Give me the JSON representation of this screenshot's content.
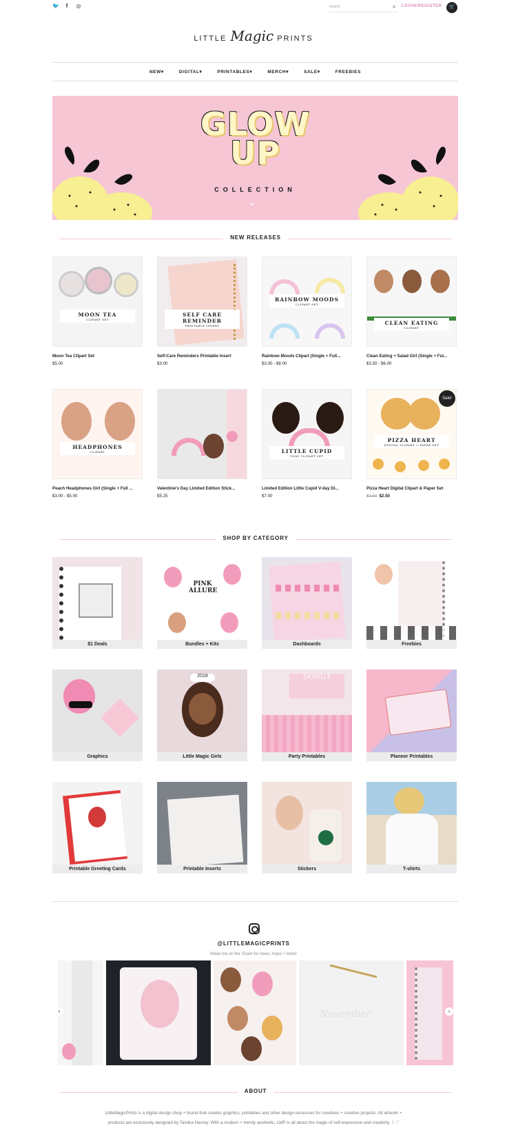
{
  "topbar": {
    "social_icons": [
      "twitter-icon",
      "facebook-icon",
      "instagram-icon"
    ],
    "search_placeholder": "Search",
    "login_label": "LOGIN/REGISTER"
  },
  "logo": {
    "left": "LITTLE",
    "middle": "Magic",
    "right": "PRINTS"
  },
  "nav": [
    "NEW",
    "DIGITAL",
    "PRINTABLES",
    "MERCH",
    "SALE",
    "FREEBIES"
  ],
  "hero": {
    "title_line1": "GLOW",
    "title_line2": "UP",
    "subtitle": "COLLECTION"
  },
  "new_releases": {
    "title": "NEW RELEASES",
    "products": [
      {
        "name": "Moon Tea Clipart Set",
        "price": "$5.00",
        "label": "MOON TEA",
        "sub": "CLIPART SET"
      },
      {
        "name": "Self-Care Reminders Printable Insert",
        "price": "$3.00",
        "label": "SELF CARE REMINDER",
        "sub": "PRINTABLE INSERT"
      },
      {
        "name": "Rainbow Moods Clipart (Single + Full...",
        "price": "$3.00 - $8.00",
        "label": "RAINBOW MOODS",
        "sub": "CLIPART SET"
      },
      {
        "name": "Clean Eating + Salad Girl (Single + Ful...",
        "price": "$3.50 - $6.00",
        "label": "CLEAN EATING",
        "sub": "CLIPART"
      },
      {
        "name": "Peach Headphones Girl (Single + Full ...",
        "price": "$3.00 - $5.00",
        "label": "HEADPHONES",
        "sub": "CLIPART"
      },
      {
        "name": "Valentine's Day Limited Edition Stick...",
        "price": "$5.25",
        "label": "",
        "sub": ""
      },
      {
        "name": "Limited Edition Little Cupid V-day Di...",
        "price": "$7.00",
        "label": "LITTLE CUPID",
        "sub": "VDAY CLIPART SET"
      },
      {
        "name": "Pizza Heart Digital Clipart & Paper Set",
        "old_price": "$3.50",
        "price": "$2.50",
        "label": "PIZZA HEART",
        "sub": "DIGITAL CLIPART + PAPER SET",
        "badge": "Sale!"
      }
    ]
  },
  "categories": {
    "title": "SHOP BY CATEGORY",
    "items": [
      "$1 Deals",
      "Bundles + Kits",
      "Dashboards",
      "Freebies",
      "Graphics",
      "Little Magic Girls",
      "Party Printables",
      "Planner Printables",
      "Printable Greeting Cards",
      "Printable Inserts",
      "Stickers",
      "T-shirts"
    ]
  },
  "instagram": {
    "handle": "@LITTLEMAGICPRINTS",
    "subtitle": "follow me on the 'Gram for news, inspo + more!"
  },
  "about": {
    "title": "ABOUT",
    "text": "LittleMagicPrints is a digital design shop + brand that creates graphics, printables and other design resources for creatives + creative projects. All artwork + products are exclusively designed by Tamika Harvey. With a modern + trendy aesthetic, LMP is all about the magic of self-expression and creativity. ☾♡"
  },
  "colors": {
    "accent_pink": "#f6c6d5",
    "login_pink": "#d98ab8",
    "label_gray": "#ececec"
  }
}
